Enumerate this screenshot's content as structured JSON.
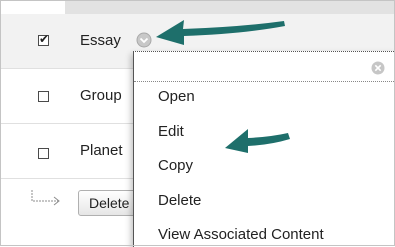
{
  "rows": [
    {
      "label": "Essay",
      "checked": true
    },
    {
      "label": "Group",
      "checked": false
    },
    {
      "label": "Planet",
      "checked": false
    }
  ],
  "checkbox_tick": "✔",
  "delete_button": {
    "label": "Delete"
  },
  "menu": {
    "items": [
      "Open",
      "Edit",
      "Copy",
      "Delete",
      "View Associated Content"
    ],
    "close_icon": "close-icon"
  },
  "colors": {
    "arrow": "#1e6f6b",
    "selected_row": "#f2f2f2",
    "header_bar": "#e2e2e2"
  }
}
